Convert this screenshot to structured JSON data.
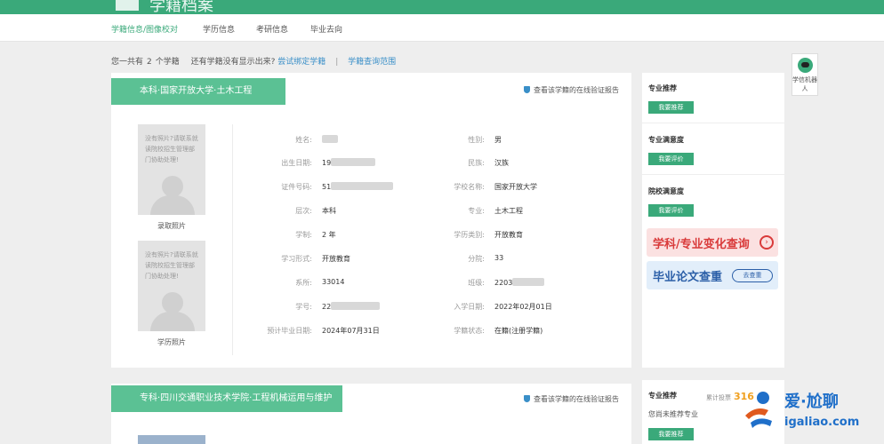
{
  "header": {
    "title": "学籍档案"
  },
  "subnav": {
    "tabs": [
      {
        "label": "学籍信息/图像校对"
      },
      {
        "label": "学历信息"
      },
      {
        "label": "考研信息"
      },
      {
        "label": "毕业去向"
      }
    ]
  },
  "summary": {
    "prefix": "您一共有",
    "count": "2",
    "suffix": "个学籍",
    "question": "还有学籍没有显示出来?",
    "bind_link": "尝试绑定学籍",
    "divider": "|",
    "range_link": "学籍查询范围"
  },
  "record1": {
    "title": "本科·国家开放大学·土木工程",
    "verify_label": "查看该学籍的在线验证报告",
    "photo_note": "没有照片?请联系就读院校招生管理部门协助处理!",
    "admission_photo_label": "录取照片",
    "degree_photo_label": "学历照片",
    "fields_left": [
      {
        "label": "姓名:",
        "value": ""
      },
      {
        "label": "出生日期:",
        "value": "19"
      },
      {
        "label": "证件号码:",
        "value": "51"
      },
      {
        "label": "层次:",
        "value": "本科"
      },
      {
        "label": "学制:",
        "value": "2 年"
      },
      {
        "label": "学习形式:",
        "value": "开放教育"
      },
      {
        "label": "系所:",
        "value": "33014"
      },
      {
        "label": "学号:",
        "value": "22"
      },
      {
        "label": "预计毕业日期:",
        "value": "2024年07月31日"
      }
    ],
    "fields_right": [
      {
        "label": "性别:",
        "value": "男"
      },
      {
        "label": "民族:",
        "value": "汉族"
      },
      {
        "label": "学校名称:",
        "value": "国家开放大学"
      },
      {
        "label": "专业:",
        "value": "土木工程"
      },
      {
        "label": "学历类别:",
        "value": "开放教育"
      },
      {
        "label": "分院:",
        "value": "33"
      },
      {
        "label": "班级:",
        "value": "2203"
      },
      {
        "label": "入学日期:",
        "value": "2022年02月01日"
      },
      {
        "label": "学籍状态:",
        "value": "在籍(注册学籍)"
      }
    ]
  },
  "record2": {
    "title": "专科·四川交通职业技术学院·工程机械运用与维护",
    "verify_label": "查看该学籍的在线验证报告"
  },
  "sidebar1": {
    "major_recommend": "专业推荐",
    "major_recommend_btn": "我要推荐",
    "major_satisfaction": "专业满意度",
    "major_satisfaction_btn": "我要评价",
    "school_satisfaction": "院校满意度",
    "school_satisfaction_btn": "我要评价",
    "banner1": "学科/专业变化查询",
    "banner1_arrow": "›",
    "banner2": "毕业论文查重",
    "banner2_pill": "去查重"
  },
  "sidebar2": {
    "major_recommend": "专业推荐",
    "count_label": "累计投票",
    "count_value": "316",
    "none": "您尚未推荐专业",
    "btn": "我要推荐"
  },
  "robot": {
    "label": "学信机器人"
  },
  "watermark": {
    "line1": "爱·尬聊",
    "line2": "igaliao.com"
  }
}
